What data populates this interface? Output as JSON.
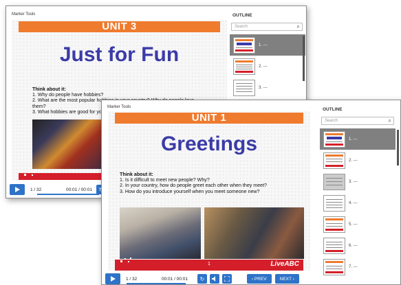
{
  "back_window": {
    "toolbar_title": "Marker Tools",
    "unit": "UNIT 3",
    "title": "Just for Fun",
    "think_heading": "Think about it:",
    "think_lines": [
      "1. Why do people have hobbies?",
      "2. What are the most popular hobbies in your country? Why do people love",
      "    them?",
      "3. What hobbies are good for yo"
    ],
    "page_count": "1 / 32",
    "time": "00:01 / 00:01",
    "outline_label": "OUTLINE",
    "search_placeholder": "Search",
    "thumb_labels": [
      "1. ---",
      "2. ---",
      "3. ---"
    ]
  },
  "front_window": {
    "toolbar_title": "Marker Tools",
    "unit": "UNIT 1",
    "title": "Greetings",
    "think_heading": "Think about it:",
    "think_lines": [
      "1. Is it difficult to meet new people? Why?",
      "2. In your country, how do people greet each other when they meet?",
      "3. How do you introduce yourself when you meet someone new?"
    ],
    "slide_page": "1",
    "logo": "LiveABC",
    "page_count": "1 / 32",
    "time": "00:01 / 00:01",
    "prev_label": "‹ PREV",
    "next_label": "NEXT ›",
    "outline_label": "OUTLINE",
    "search_placeholder": "Search",
    "thumb_labels": [
      "1. ---",
      "2. ---",
      "3. ---",
      "4. ---",
      "5. ---",
      "6. ---",
      "7. ---"
    ]
  },
  "colors": {
    "unit_orange": "#ef7b2e",
    "title_blue": "#3b3ba8",
    "footer_red": "#d41f2a",
    "button_blue": "#2e73c8"
  },
  "icons": {
    "play": "play-icon",
    "refresh": "refresh-icon",
    "volume": "volume-icon",
    "fullscreen": "fullscreen-icon",
    "search": "search-icon"
  }
}
